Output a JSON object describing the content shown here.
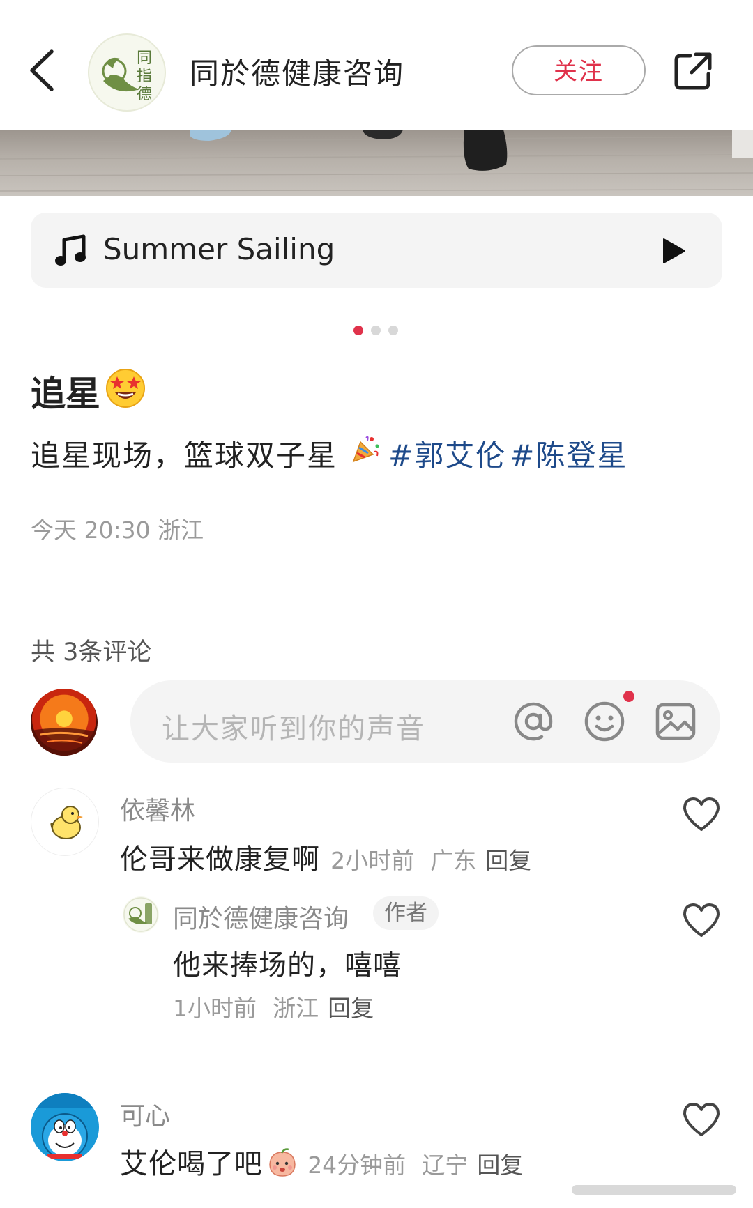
{
  "header": {
    "account_name": "同於德健康咨询",
    "follow_label": "关注",
    "logo_text": "同指德"
  },
  "music": {
    "title": "Summer Sailing"
  },
  "carousel": {
    "count": 3,
    "active_index": 0
  },
  "post": {
    "title": "追星",
    "body_text": "追星现场，篮球双子星",
    "tags": [
      "#郭艾伦",
      "#陈登星"
    ],
    "meta": "今天 20:30 浙江"
  },
  "comments_section": {
    "count_label": "共 3条评论",
    "input_placeholder": "让大家听到你的声音"
  },
  "comments": [
    {
      "user": "依馨林",
      "text": "伦哥来做康复啊",
      "time": "2小时前",
      "location": "广东",
      "reply_label": "回复",
      "replies": [
        {
          "user": "同於德健康咨询",
          "badge": "作者",
          "text": "他来捧场的，嘻嘻",
          "time": "1小时前",
          "location": "浙江",
          "reply_label": "回复"
        }
      ]
    },
    {
      "user": "可心",
      "text": "艾伦喝了吧",
      "time": "24分钟前",
      "location": "辽宁",
      "reply_label": "回复"
    }
  ],
  "colors": {
    "accent": "#e0324b",
    "tag": "#1e4a8a",
    "logo_green": "#5a7a3a"
  }
}
